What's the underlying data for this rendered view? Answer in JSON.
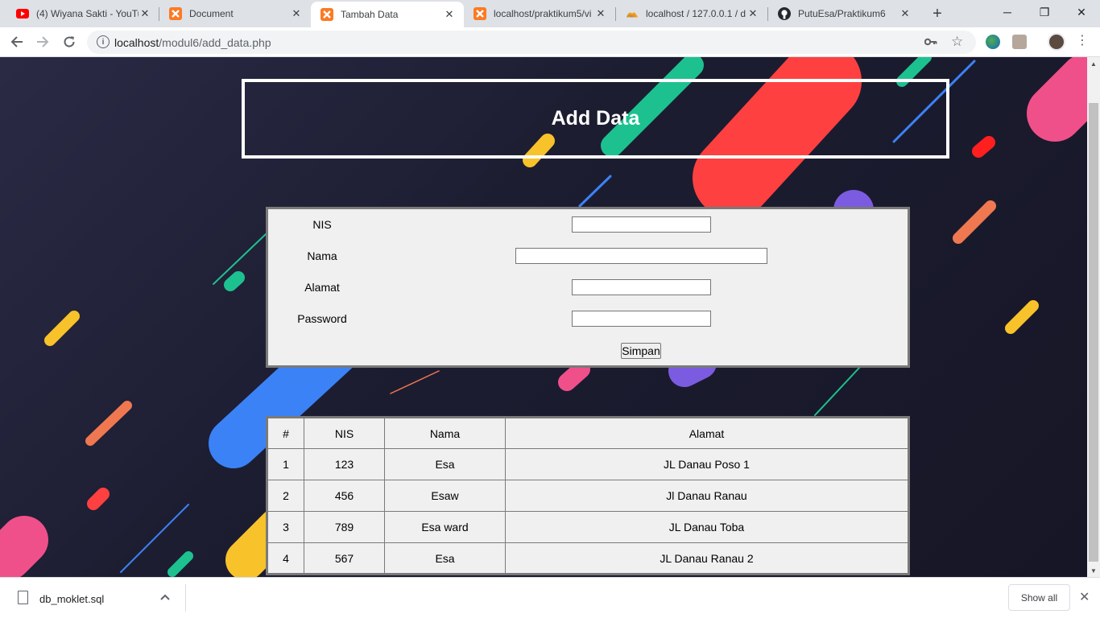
{
  "browser": {
    "tabs": [
      {
        "title": "(4) Wiyana Sakti - YouTube",
        "icon": "youtube-icon"
      },
      {
        "title": "Document",
        "icon": "xampp-icon"
      },
      {
        "title": "Tambah Data",
        "icon": "xampp-icon",
        "active": true
      },
      {
        "title": "localhost/praktikum5/vi",
        "icon": "xampp-icon"
      },
      {
        "title": "localhost / 127.0.0.1 / d",
        "icon": "phpmyadmin-icon"
      },
      {
        "title": "PutuEsa/Praktikum6",
        "icon": "github-icon"
      }
    ],
    "url_host": "localhost",
    "url_path": "/modul6/add_data.php"
  },
  "page": {
    "heading": "Add Data",
    "form": {
      "nis_label": "NIS",
      "nama_label": "Nama",
      "alamat_label": "Alamat",
      "password_label": "Password",
      "submit_label": "Simpan"
    },
    "table": {
      "headers": [
        "#",
        "NIS",
        "Nama",
        "Alamat"
      ],
      "rows": [
        [
          "1",
          "123",
          "Esa",
          "JL Danau Poso 1"
        ],
        [
          "2",
          "456",
          "Esaw",
          "Jl Danau Ranau"
        ],
        [
          "3",
          "789",
          "Esa ward",
          "JL Danau Toba"
        ],
        [
          "4",
          "567",
          "Esa",
          "JL Danau Ranau 2"
        ]
      ]
    }
  },
  "downloads": {
    "file_name": "db_moklet.sql",
    "show_all_label": "Show all"
  },
  "colors": {
    "accent_red": "#ff4040",
    "accent_green": "#1dc18f",
    "accent_blue": "#3b82f6",
    "accent_yellow": "#f7c22a",
    "accent_pink": "#f0508a",
    "accent_purple": "#7b5ce0",
    "accent_orange": "#f07850"
  }
}
